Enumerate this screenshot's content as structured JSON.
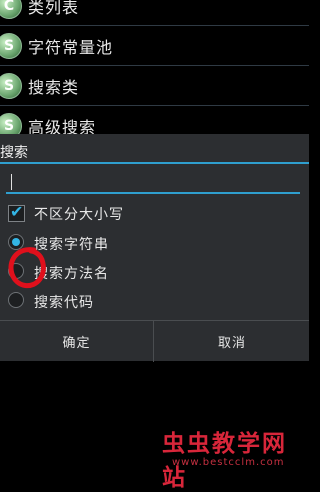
{
  "list": {
    "items": [
      {
        "badge": "C",
        "label": "类列表"
      },
      {
        "badge": "S",
        "label": "字符常量池"
      },
      {
        "badge": "S",
        "label": "搜索类"
      },
      {
        "badge": "S",
        "label": "高级搜索"
      }
    ]
  },
  "dialog": {
    "title": "搜索",
    "input_value": "",
    "checkbox": {
      "label": "不区分大小写",
      "checked": true
    },
    "radios": [
      {
        "label": "搜索字符串",
        "selected": true
      },
      {
        "label": "搜索方法名",
        "selected": false
      },
      {
        "label": "搜索代码",
        "selected": false
      }
    ],
    "buttons": {
      "ok": "确定",
      "cancel": "取消"
    }
  },
  "watermark": {
    "title": "虫虫教学网站",
    "url": "www.bestcclm.com"
  },
  "colors": {
    "accent": "#33b5e5",
    "annotation": "#e0101c",
    "watermark": "#d8263a"
  }
}
